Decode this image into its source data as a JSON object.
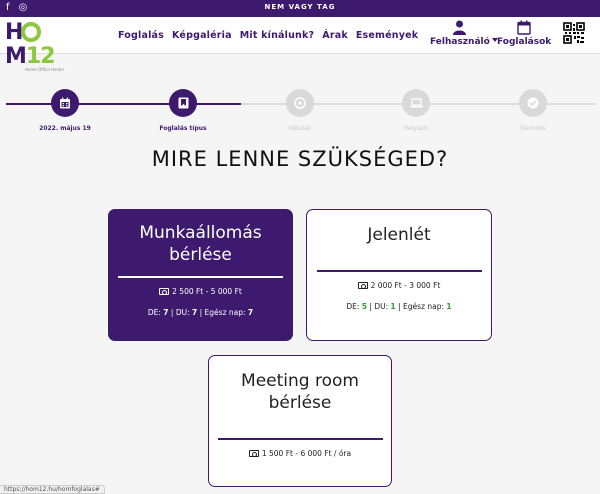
{
  "topbar": {
    "user_status": "NEM VAGY TAG",
    "social": [
      {
        "icon": "facebook-icon",
        "glyph": "f"
      },
      {
        "icon": "instagram-icon",
        "glyph": "◎"
      }
    ]
  },
  "logo": {
    "main_left": "H",
    "main_right": "M",
    "number": "12",
    "tagline": "Home Office Hoster"
  },
  "nav": {
    "menu": [
      "Foglalás",
      "Képgaléria",
      "Mit kínálunk?",
      "Árak",
      "Események"
    ],
    "user_label": "Felhasználó",
    "bookings_label": "Foglalások"
  },
  "stepper": {
    "steps": [
      {
        "label": "2022. május 19",
        "icon": "calendar-icon",
        "state": "active"
      },
      {
        "label": "Foglalás típus",
        "icon": "bookmark-icon",
        "state": "active"
      },
      {
        "label": "Időszak",
        "icon": "clock-icon",
        "state": "inactive"
      },
      {
        "label": "Helyszín",
        "icon": "laptop-icon",
        "state": "inactive"
      },
      {
        "label": "Elemzés",
        "icon": "check-icon",
        "state": "inactive"
      }
    ]
  },
  "heading": "MIRE LENNE SZÜKSÉGED?",
  "cards": [
    {
      "title_line1": "Munkaállomás",
      "title_line2": "bérlése",
      "price": "2 500 Ft - 5 000 Ft",
      "slots": {
        "de_label": "DE:",
        "de": "7",
        "sep1": "|",
        "du_label": "DU:",
        "du": "7",
        "sep2": "|",
        "full_label": "Egész nap:",
        "full": "7"
      },
      "selected": true
    },
    {
      "title_line1": "Jelenlét",
      "price": "2 000 Ft - 3 000 Ft",
      "slots": {
        "de_label": "DE:",
        "de": "5",
        "sep1": "|",
        "du_label": "DU:",
        "du": "1",
        "sep2": "|",
        "full_label": "Egész nap:",
        "full": "1"
      },
      "selected": false
    },
    {
      "title_line1": "Meeting room bérlése",
      "price": "1 500 Ft - 6 000 Ft / óra",
      "selected": false
    }
  ],
  "status_url": "https://hom12.hu/homfoglalas#",
  "colors": {
    "primary": "#3d1a6e",
    "accent": "#8dc63f",
    "slot_green": "#2e9d2e"
  }
}
